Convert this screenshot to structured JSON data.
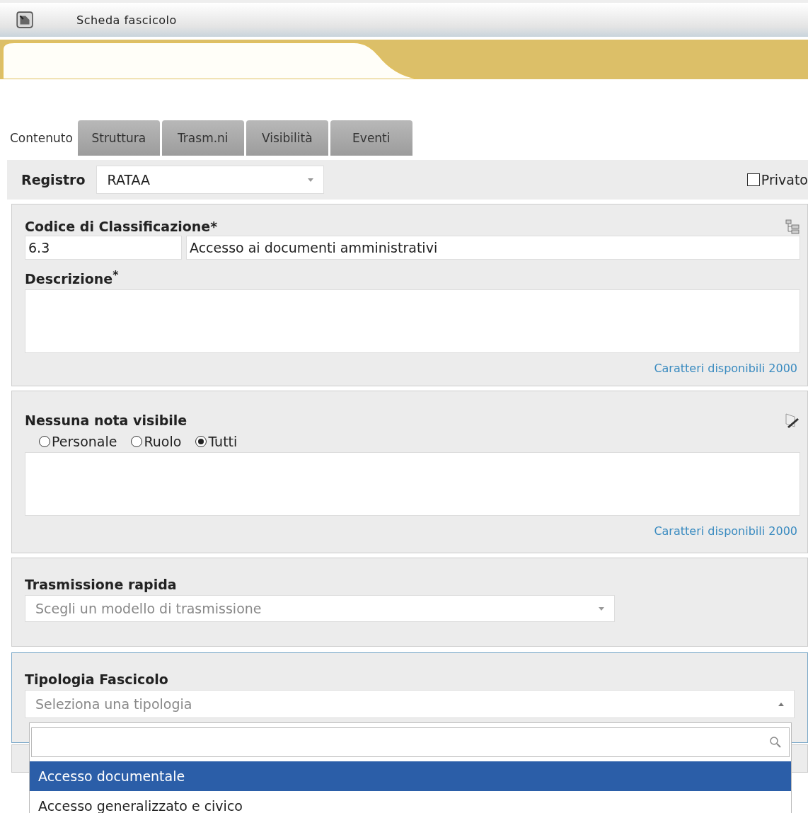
{
  "header": {
    "title": "Scheda fascicolo"
  },
  "tabs": [
    {
      "label": "Contenuto",
      "selected": true
    },
    {
      "label": "Struttura",
      "selected": false
    },
    {
      "label": "Trasm.ni",
      "selected": false
    },
    {
      "label": "Visibilità",
      "selected": false
    },
    {
      "label": "Eventi",
      "selected": false
    }
  ],
  "registro": {
    "label": "Registro",
    "value": "RATAA"
  },
  "privato": {
    "label": "Privato",
    "checked": false
  },
  "classificazione": {
    "label": "Codice di Classificazione*",
    "code": "6.3",
    "description": "Accesso ai documenti amministrativi"
  },
  "descrizione": {
    "label": "Descrizione$^{*}$",
    "counter": "Caratteri disponibili 2000"
  },
  "note": {
    "title": "Nessuna nota visibile",
    "options": [
      {
        "label": "Personale",
        "selected": false
      },
      {
        "label": "Ruolo",
        "selected": false
      },
      {
        "label": "Tutti",
        "selected": true
      }
    ],
    "counter": "Caratteri disponibili 2000"
  },
  "trasmissione": {
    "label": "Trasmissione rapida",
    "placeholder": "Scegli un modello di trasmissione"
  },
  "tipologia": {
    "label": "Tipologia Fascicolo",
    "placeholder": "Seleziona una tipologia",
    "expanded": true,
    "options": [
      {
        "label": "Accesso documentale",
        "selected": true
      },
      {
        "label": "Accesso generalizzato e civico",
        "selected": false
      }
    ]
  }
}
